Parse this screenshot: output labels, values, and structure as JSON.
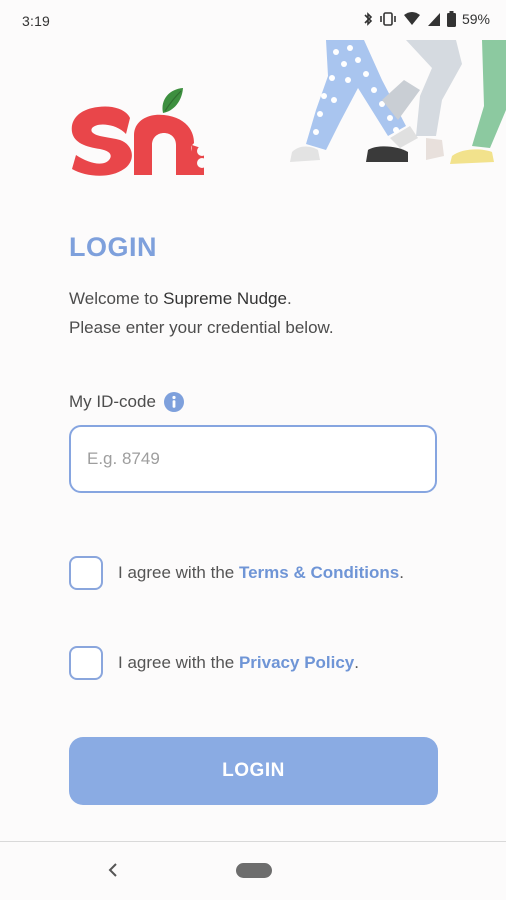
{
  "status_bar": {
    "time": "3:19",
    "battery": "59%",
    "icons": [
      "bluetooth-icon",
      "vibrate-icon",
      "wifi-icon",
      "cell-signal-icon",
      "battery-icon"
    ]
  },
  "login": {
    "title": "LOGIN",
    "welcome_prefix": "Welcome to ",
    "app_name": "Supreme Nudge",
    "welcome_suffix": ".",
    "instruction": "Please enter your credential below."
  },
  "id_field": {
    "label": "My ID-code",
    "placeholder": "E.g. 8749",
    "value": ""
  },
  "terms": {
    "prefix": "I agree with the ",
    "link": "Terms & Conditions",
    "suffix": ".",
    "checked": false
  },
  "privacy": {
    "prefix": "I agree with the ",
    "link": "Privacy Policy",
    "suffix": ".",
    "checked": false
  },
  "login_button": {
    "label": "LOGIN"
  },
  "colors": {
    "accent": "#7ea0dc",
    "button": "#8aabe3",
    "logo_red": "#e9464a",
    "leaf_green": "#3d8f3f"
  }
}
